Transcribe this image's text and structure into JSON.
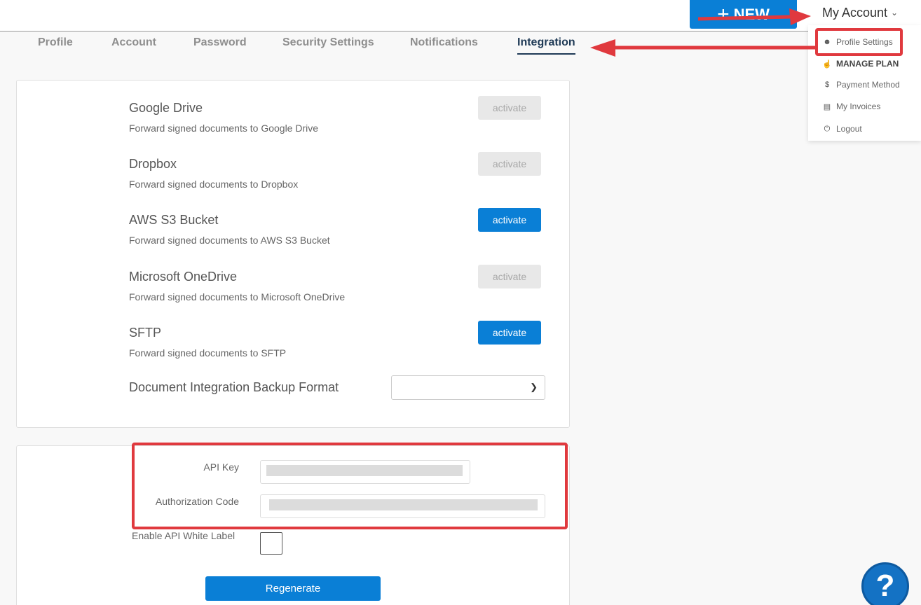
{
  "header": {
    "new_label": "NEW",
    "account_label": "My Account"
  },
  "tabs": [
    {
      "label": "Profile"
    },
    {
      "label": "Account"
    },
    {
      "label": "Password"
    },
    {
      "label": "Security Settings"
    },
    {
      "label": "Notifications"
    },
    {
      "label": "Integration",
      "active": true
    }
  ],
  "integrations": [
    {
      "title": "Google Drive",
      "desc": "Forward signed documents to Google Drive",
      "button": "activate",
      "enabled": false
    },
    {
      "title": "Dropbox",
      "desc": "Forward signed documents to Dropbox",
      "button": "activate",
      "enabled": false
    },
    {
      "title": "AWS S3 Bucket",
      "desc": "Forward signed documents to AWS S3 Bucket",
      "button": "activate",
      "enabled": true
    },
    {
      "title": "Microsoft OneDrive",
      "desc": "Forward signed documents to Microsoft OneDrive",
      "button": "activate",
      "enabled": false
    },
    {
      "title": "SFTP",
      "desc": "Forward signed documents to SFTP",
      "button": "activate",
      "enabled": true
    }
  ],
  "backup": {
    "label": "Document Integration Backup Format",
    "selected": ""
  },
  "api": {
    "api_key_label": "API Key",
    "auth_code_label": "Authorization Code",
    "white_label_label": "Enable API White Label",
    "regenerate_label": "Regenerate"
  },
  "menu": {
    "items": [
      {
        "label": "Profile Settings",
        "icon": "user-icon"
      },
      {
        "label": "MANAGE PLAN",
        "icon": "thumbs-up-icon"
      },
      {
        "label": "Payment Method",
        "icon": "dollar-icon"
      },
      {
        "label": "My Invoices",
        "icon": "invoice-icon"
      },
      {
        "label": "Logout",
        "icon": "power-icon"
      }
    ]
  },
  "help": {
    "label": "?"
  },
  "colors": {
    "primary": "#0a7fd6",
    "annotation": "#e0393e",
    "active_tab": "#1f3a56"
  }
}
